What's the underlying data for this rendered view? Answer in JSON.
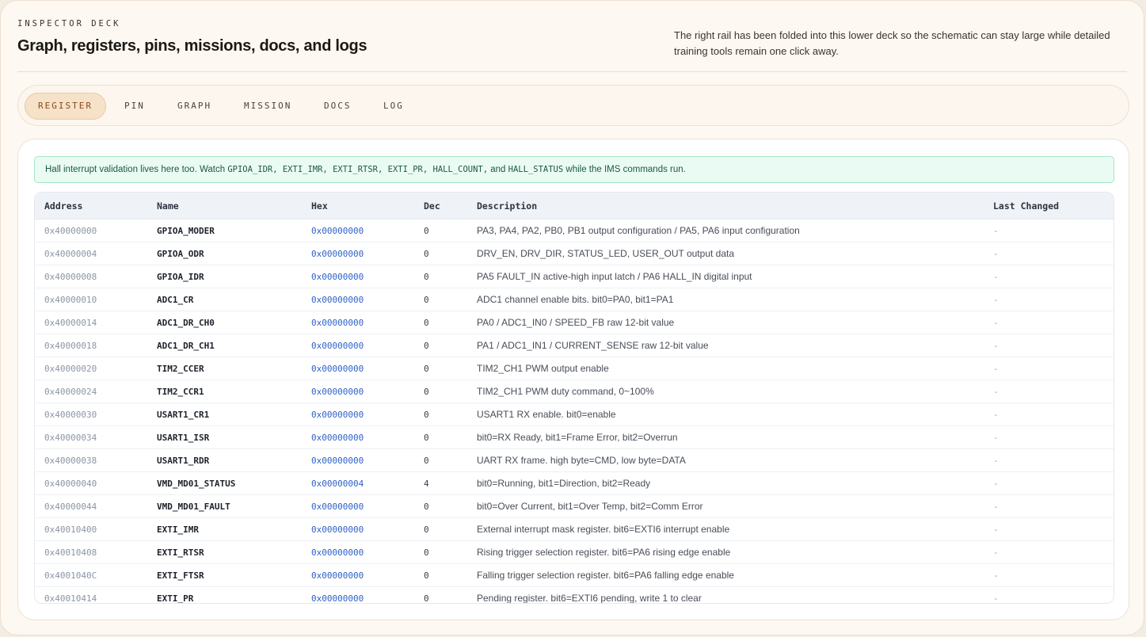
{
  "header": {
    "eyebrow": "INSPECTOR DECK",
    "title": "Graph, registers, pins, missions, docs, and logs",
    "note": "The right rail has been folded into this lower deck so the schematic can stay large while detailed training tools remain one click away."
  },
  "tabs": [
    {
      "label": "REGISTER",
      "active": true
    },
    {
      "label": "PIN",
      "active": false
    },
    {
      "label": "GRAPH",
      "active": false
    },
    {
      "label": "MISSION",
      "active": false
    },
    {
      "label": "DOCS",
      "active": false
    },
    {
      "label": "LOG",
      "active": false
    }
  ],
  "callout": {
    "text_before": "Hall interrupt validation lives here too. Watch ",
    "code_regs": "GPIOA_IDR, EXTI_IMR, EXTI_RTSR, EXTI_PR, HALL_COUNT,",
    "text_and": " and ",
    "code_status": "HALL_STATUS",
    "text_after": " while the IMS commands run."
  },
  "table": {
    "columns": {
      "address": "Address",
      "name": "Name",
      "hex": "Hex",
      "dec": "Dec",
      "description": "Description",
      "last_changed": "Last Changed"
    },
    "rows": [
      {
        "address": "0x40000000",
        "name": "GPIOA_MODER",
        "hex": "0x00000000",
        "dec": "0",
        "description": "PA3, PA4, PA2, PB0, PB1 output configuration / PA5, PA6 input configuration",
        "last_changed": "-"
      },
      {
        "address": "0x40000004",
        "name": "GPIOA_ODR",
        "hex": "0x00000000",
        "dec": "0",
        "description": "DRV_EN, DRV_DIR, STATUS_LED, USER_OUT output data",
        "last_changed": "-"
      },
      {
        "address": "0x40000008",
        "name": "GPIOA_IDR",
        "hex": "0x00000000",
        "dec": "0",
        "description": "PA5 FAULT_IN active-high input latch / PA6 HALL_IN digital input",
        "last_changed": "-"
      },
      {
        "address": "0x40000010",
        "name": "ADC1_CR",
        "hex": "0x00000000",
        "dec": "0",
        "description": "ADC1 channel enable bits. bit0=PA0, bit1=PA1",
        "last_changed": "-"
      },
      {
        "address": "0x40000014",
        "name": "ADC1_DR_CH0",
        "hex": "0x00000000",
        "dec": "0",
        "description": "PA0 / ADC1_IN0 / SPEED_FB raw 12-bit value",
        "last_changed": "-"
      },
      {
        "address": "0x40000018",
        "name": "ADC1_DR_CH1",
        "hex": "0x00000000",
        "dec": "0",
        "description": "PA1 / ADC1_IN1 / CURRENT_SENSE raw 12-bit value",
        "last_changed": "-"
      },
      {
        "address": "0x40000020",
        "name": "TIM2_CCER",
        "hex": "0x00000000",
        "dec": "0",
        "description": "TIM2_CH1 PWM output enable",
        "last_changed": "-"
      },
      {
        "address": "0x40000024",
        "name": "TIM2_CCR1",
        "hex": "0x00000000",
        "dec": "0",
        "description": "TIM2_CH1 PWM duty command, 0~100%",
        "last_changed": "-"
      },
      {
        "address": "0x40000030",
        "name": "USART1_CR1",
        "hex": "0x00000000",
        "dec": "0",
        "description": "USART1 RX enable. bit0=enable",
        "last_changed": "-"
      },
      {
        "address": "0x40000034",
        "name": "USART1_ISR",
        "hex": "0x00000000",
        "dec": "0",
        "description": "bit0=RX Ready, bit1=Frame Error, bit2=Overrun",
        "last_changed": "-"
      },
      {
        "address": "0x40000038",
        "name": "USART1_RDR",
        "hex": "0x00000000",
        "dec": "0",
        "description": "UART RX frame. high byte=CMD, low byte=DATA",
        "last_changed": "-"
      },
      {
        "address": "0x40000040",
        "name": "VMD_MD01_STATUS",
        "hex": "0x00000004",
        "dec": "4",
        "description": "bit0=Running, bit1=Direction, bit2=Ready",
        "last_changed": "-"
      },
      {
        "address": "0x40000044",
        "name": "VMD_MD01_FAULT",
        "hex": "0x00000000",
        "dec": "0",
        "description": "bit0=Over Current, bit1=Over Temp, bit2=Comm Error",
        "last_changed": "-"
      },
      {
        "address": "0x40010400",
        "name": "EXTI_IMR",
        "hex": "0x00000000",
        "dec": "0",
        "description": "External interrupt mask register. bit6=EXTI6 interrupt enable",
        "last_changed": "-"
      },
      {
        "address": "0x40010408",
        "name": "EXTI_RTSR",
        "hex": "0x00000000",
        "dec": "0",
        "description": "Rising trigger selection register. bit6=PA6 rising edge enable",
        "last_changed": "-"
      },
      {
        "address": "0x4001040C",
        "name": "EXTI_FTSR",
        "hex": "0x00000000",
        "dec": "0",
        "description": "Falling trigger selection register. bit6=PA6 falling edge enable",
        "last_changed": "-"
      },
      {
        "address": "0x40010414",
        "name": "EXTI_PR",
        "hex": "0x00000000",
        "dec": "0",
        "description": "Pending register. bit6=EXTI6 pending, write 1 to clear",
        "last_changed": "-"
      }
    ]
  },
  "colors": {
    "accent_tab_bg": "#f6e2c9",
    "accent_tab_text": "#8a4a18",
    "callout_bg": "#eafbf3",
    "callout_border": "#a9e5c7",
    "hex_value": "#2f62c8"
  }
}
